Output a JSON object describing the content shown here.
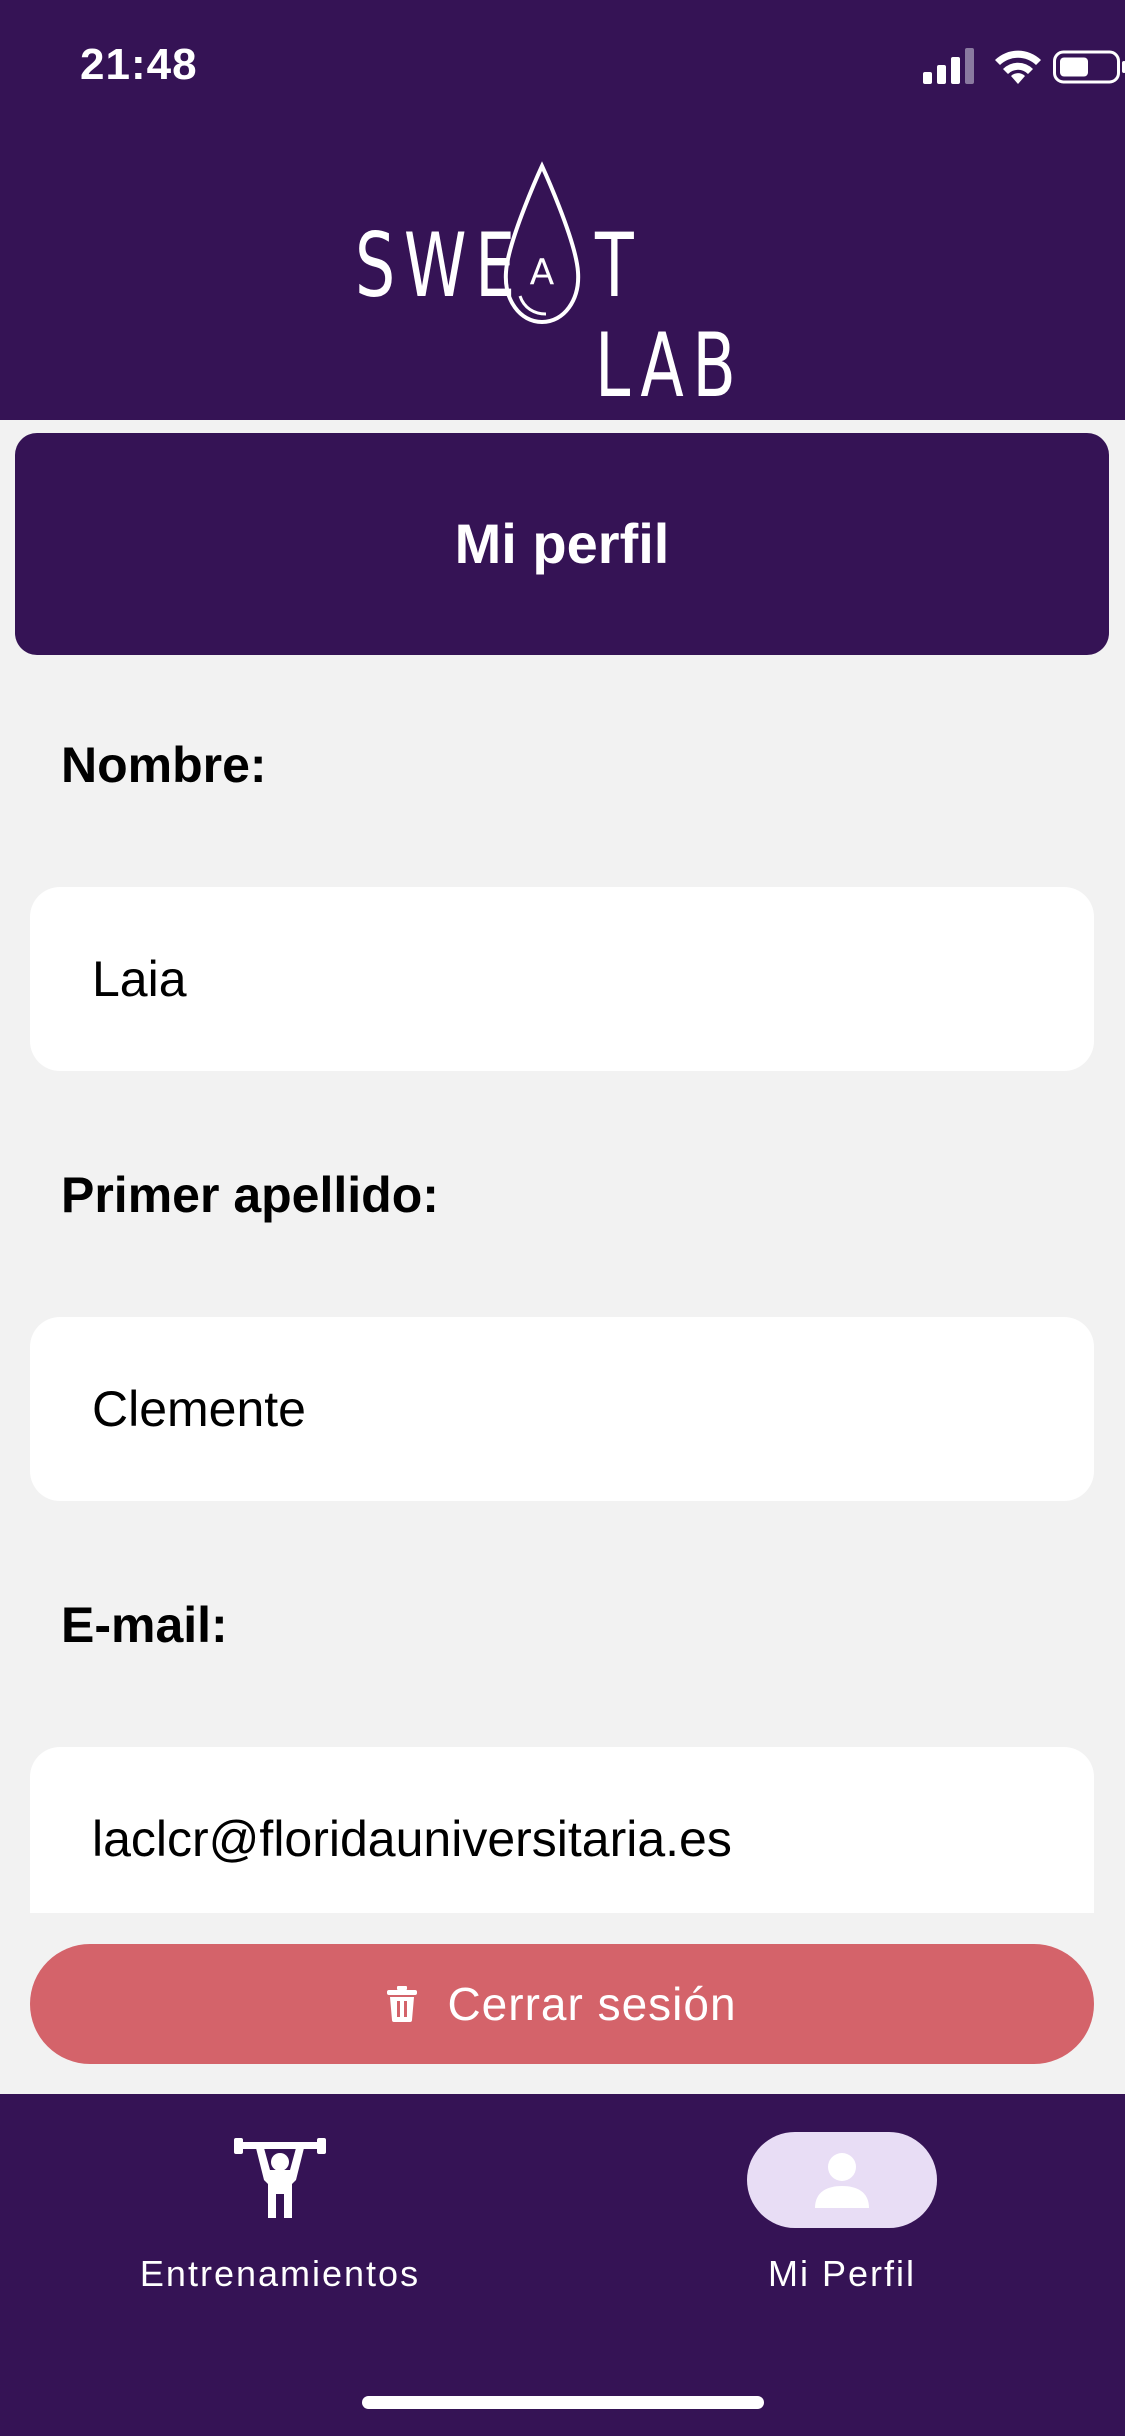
{
  "status_bar": {
    "time": "21:48"
  },
  "brand": {
    "name": "SWEAT LAB",
    "left": "SWE",
    "drop_letter": "A",
    "right": "T LAB"
  },
  "header": {
    "title": "Mi perfil"
  },
  "form": {
    "fields": [
      {
        "label": "Nombre:",
        "value": "Laia"
      },
      {
        "label": "Primer apellido:",
        "value": "Clemente"
      },
      {
        "label": "E-mail:",
        "value": "laclcr@floridauniversitaria.es"
      }
    ]
  },
  "logout": {
    "label": "Cerrar sesión",
    "icon": "trash-icon"
  },
  "nav": {
    "items": [
      {
        "label": "Entrenamientos",
        "icon": "weightlifter-icon",
        "active": false
      },
      {
        "label": "Mi Perfil",
        "icon": "person-icon",
        "active": true
      }
    ]
  },
  "colors": {
    "primary": "#351355",
    "background": "#f2f2f2",
    "danger": "#d4636a",
    "active_pill": "#e8ddf5"
  }
}
